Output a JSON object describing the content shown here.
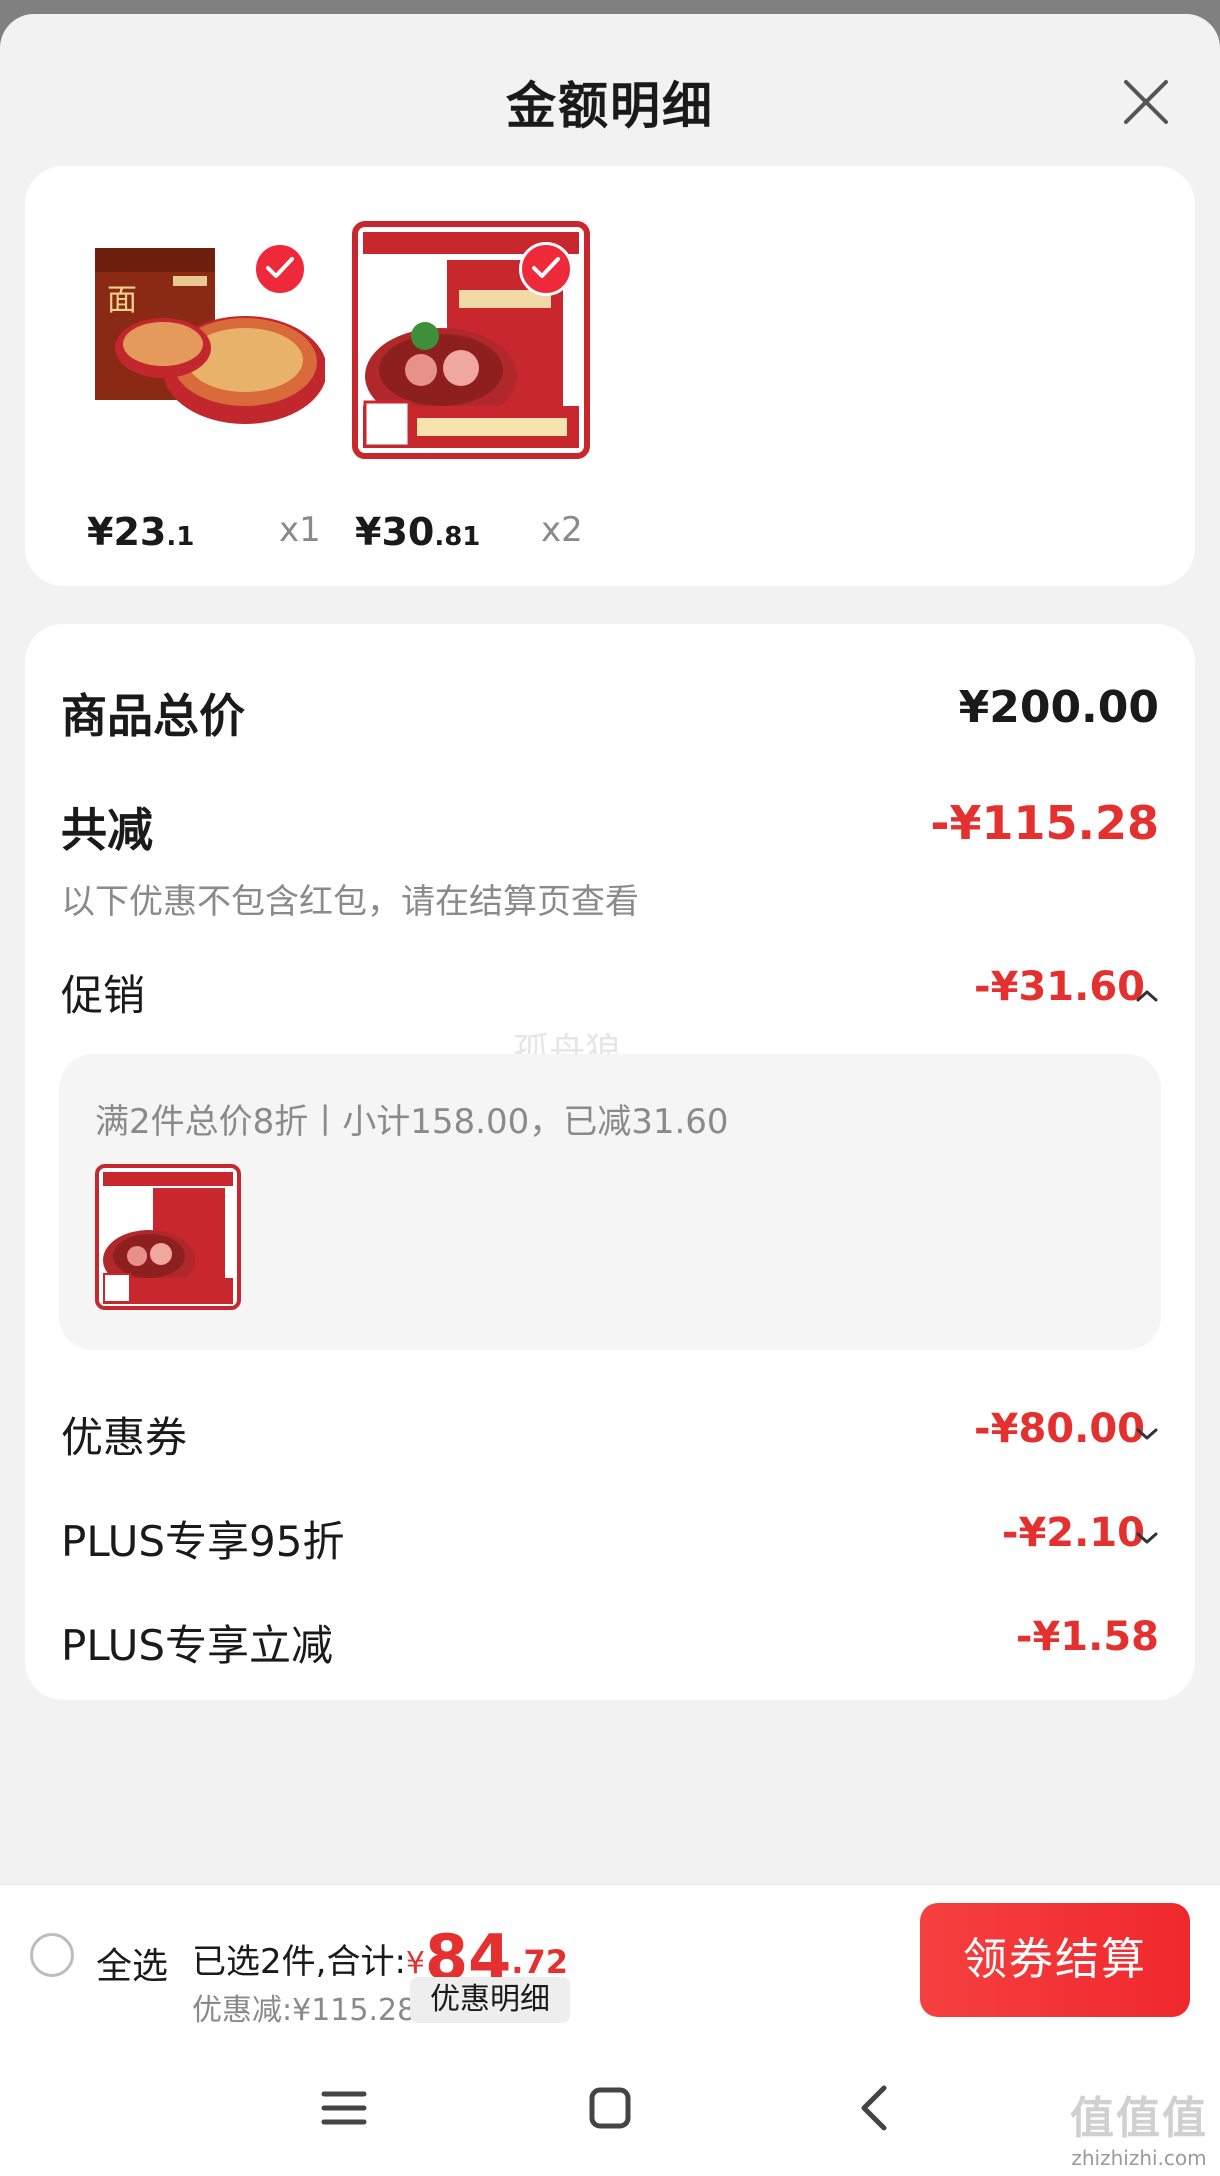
{
  "header": {
    "title": "金额明细",
    "close_icon": "close-icon"
  },
  "products": [
    {
      "price_int": "¥23",
      "price_dec": ".1",
      "qty": "x1",
      "checked": true
    },
    {
      "price_int": "¥30",
      "price_dec": ".81",
      "qty": "x2",
      "checked": true
    }
  ],
  "detail": {
    "total_label": "商品总价",
    "total_value": "¥200.00",
    "reduce_label": "共减",
    "reduce_value": "-¥115.28",
    "reduce_note": "以下优惠不包含红包，请在结算页查看",
    "promo_label": "促销",
    "promo_value": "-¥31.60",
    "promo_desc": "满2件总价8折丨小计158.00，已减31.60",
    "coupon_label": "优惠券",
    "coupon_value": "-¥80.00",
    "plus95_label": "PLUS专享95折",
    "plus95_value": "-¥2.10",
    "plusreduce_label": "PLUS专享立减",
    "plusreduce_value": "-¥1.58"
  },
  "watermark": "孤舟狼",
  "bottom": {
    "select_all": "全选",
    "selected_text": "已选2件,合计:",
    "currency": "¥",
    "total_int": "84",
    "total_dec": ".72",
    "saved_text": "优惠减:¥115.28",
    "detail_button": "优惠明细",
    "checkout_button": "领券结算"
  },
  "site_watermark": {
    "logo": "值值值",
    "url": "zhizhizhi.com"
  },
  "colors": {
    "accent": "#e4302f",
    "check": "#ee2a3a",
    "background": "#f2f2f2"
  }
}
